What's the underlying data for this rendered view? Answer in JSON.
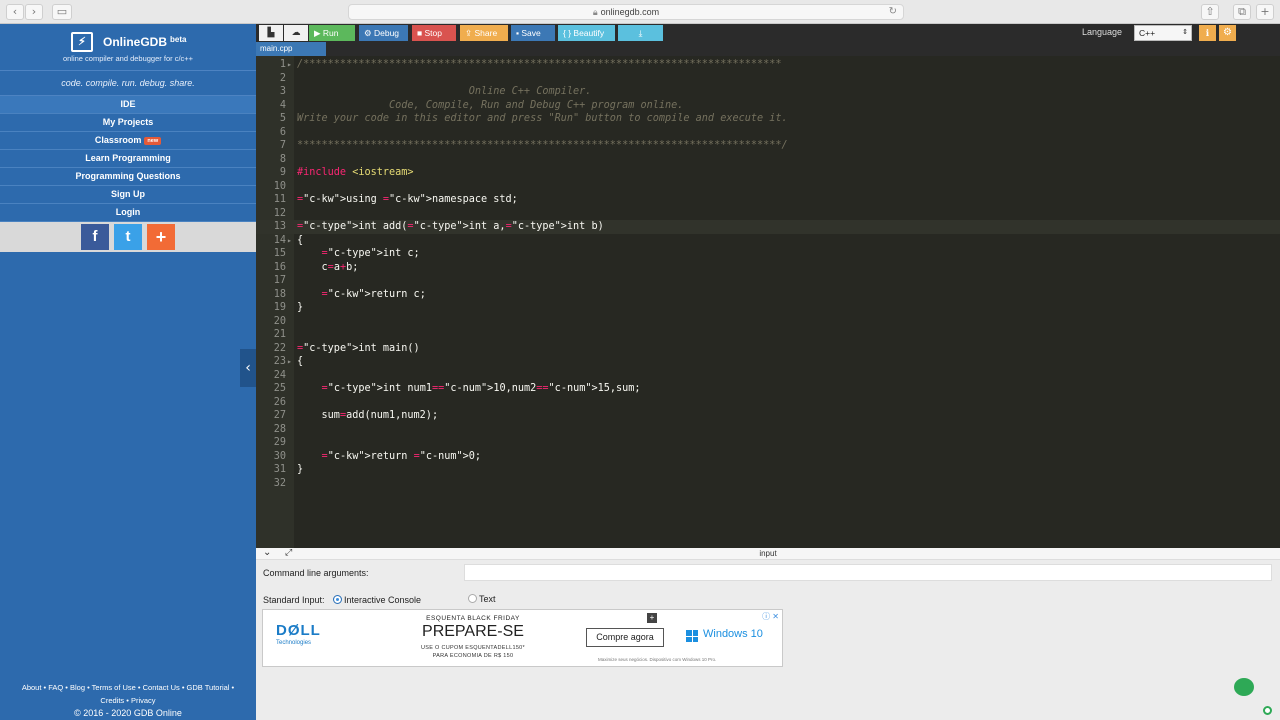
{
  "browser": {
    "url": "onlinegdb.com",
    "back": "‹",
    "forward": "›"
  },
  "sidebar": {
    "brand_name": "OnlineGDB",
    "brand_beta": "beta",
    "brand_sub": "online compiler and debugger for c/c++",
    "tagline": "code. compile. run. debug. share.",
    "items": [
      {
        "label": "IDE"
      },
      {
        "label": "My Projects"
      },
      {
        "label": "Classroom",
        "badge": "new"
      },
      {
        "label": "Learn Programming"
      },
      {
        "label": "Programming Questions"
      },
      {
        "label": "Sign Up"
      },
      {
        "label": "Login"
      }
    ],
    "social": {
      "facebook": "f",
      "twitter": "t",
      "plus": "+"
    },
    "footer_line1": "About • FAQ • Blog • Terms of Use • Contact Us • GDB Tutorial •",
    "footer_line2": "Credits • Privacy",
    "footer_copy": "© 2016 - 2020 GDB Online"
  },
  "toolbar": {
    "run": "Run",
    "debug": "Debug",
    "stop": "Stop",
    "share": "Share",
    "save": "Save",
    "beautify": "{ } Beautify",
    "language_label": "Language",
    "language_value": "C++"
  },
  "tab": {
    "filename": "main.cpp"
  },
  "editor": {
    "lines": [
      "/******************************************************************************",
      "",
      "                            Online C++ Compiler.",
      "               Code, Compile, Run and Debug C++ program online.",
      "Write your code in this editor and press \"Run\" button to compile and execute it.",
      "",
      "*******************************************************************************/",
      "",
      "#include <iostream>",
      "",
      "using namespace std;",
      "",
      "int add(int a,int b)",
      "{",
      "    int c;",
      "    c=a+b;",
      "",
      "    return c;",
      "}",
      "",
      "",
      "int main()",
      "{",
      "",
      "    int num1=10,num2=15,sum;",
      "",
      "    sum=add(num1,num2);",
      "",
      "",
      "    return 0;",
      "}",
      ""
    ]
  },
  "io": {
    "title": "input",
    "cmd_label": "Command line arguments:",
    "stdin_label": "Standard Input:",
    "option_interactive": "Interactive Console",
    "option_text": "Text"
  },
  "ad": {
    "brand": "DØLL",
    "brand_sub": "Technologies",
    "kicker": "ESQUENTA BLACK FRIDAY",
    "headline": "PREPARE-SE",
    "code_line1": "USE O CUPOM ESQUENTADELL150*",
    "code_line2": "PARA ECONOMIA DE R$ 150",
    "cta": "Compre agora",
    "windows": "Windows 10",
    "fine_print": "Maximize seus negócios. Dispositivo com Windows 10 Pro."
  },
  "colors": {
    "sidebar": "#2d6aad",
    "editor_bg": "#272822",
    "run": "#5cb85c",
    "stop": "#d9534f",
    "share": "#f0ad4e"
  }
}
